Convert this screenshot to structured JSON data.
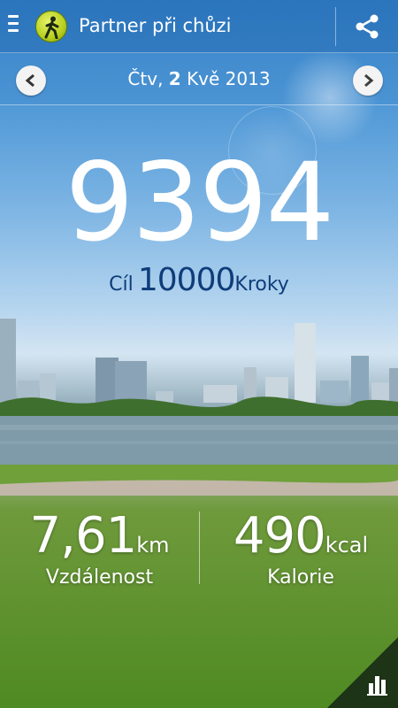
{
  "app": {
    "title": "Partner při chůzi"
  },
  "date_nav": {
    "weekday": "Čtv,",
    "day": "2",
    "month_year": "Kvě 2013"
  },
  "steps": {
    "count": "9394",
    "goal_label": "Cíl",
    "goal_value": "10000",
    "goal_unit": "Kroky"
  },
  "stats": {
    "distance": {
      "value": "7,61",
      "unit": "km",
      "label": "Vzdálenost"
    },
    "calories": {
      "value": "490",
      "unit": "kcal",
      "label": "Kalorie"
    }
  },
  "icons": {
    "menu": "menu-icon",
    "app": "walking-person-icon",
    "share": "share-icon",
    "prev": "chevron-left-icon",
    "next": "chevron-right-icon",
    "chart": "bar-chart-icon"
  },
  "colors": {
    "goal_text": "#0f3d7a",
    "app_icon": "#b6cf1d"
  }
}
